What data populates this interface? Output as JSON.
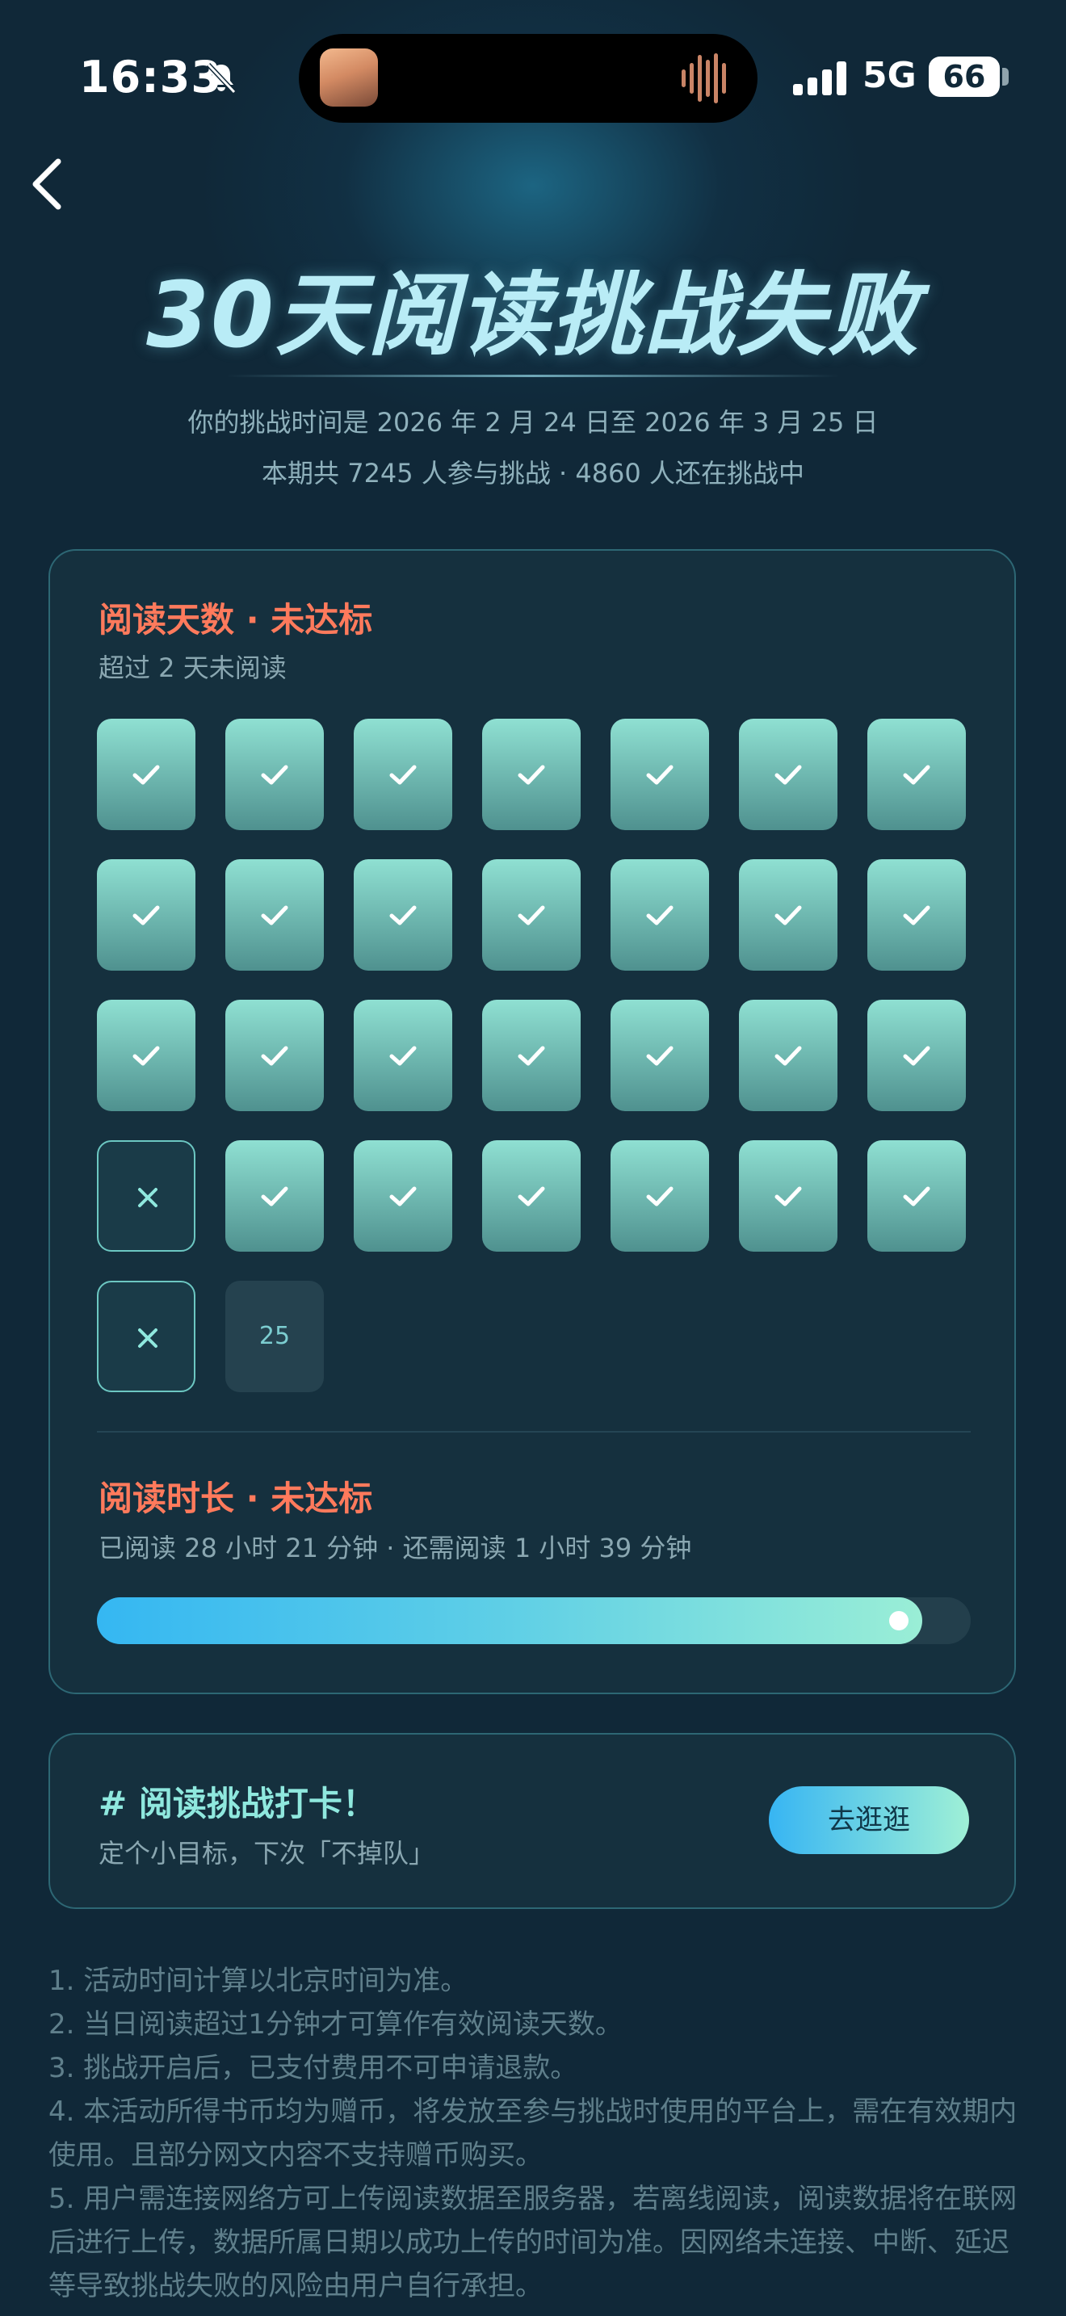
{
  "status_bar": {
    "time": "16:33",
    "network": "5G",
    "battery": "66",
    "icons": [
      "bell-muted-icon",
      "app-thumbnail-icon",
      "audio-wave-icon",
      "signal-icon",
      "battery-icon"
    ]
  },
  "nav": {
    "back_icon": "chevron-left-icon"
  },
  "header": {
    "title": "30天阅读挑战失败",
    "period": "你的挑战时间是 2026 年 2 月 24 日至 2026 年 3 月 25 日",
    "participants": "本期共 7245 人参与挑战 · 4860 人还在挑战中"
  },
  "days_section": {
    "title": "阅读天数 · 未达标",
    "subtitle": "超过 2 天未阅读",
    "days": [
      {
        "state": "ok"
      },
      {
        "state": "ok"
      },
      {
        "state": "ok"
      },
      {
        "state": "ok"
      },
      {
        "state": "ok"
      },
      {
        "state": "ok"
      },
      {
        "state": "ok"
      },
      {
        "state": "ok"
      },
      {
        "state": "ok"
      },
      {
        "state": "ok"
      },
      {
        "state": "ok"
      },
      {
        "state": "ok"
      },
      {
        "state": "ok"
      },
      {
        "state": "ok"
      },
      {
        "state": "ok"
      },
      {
        "state": "ok"
      },
      {
        "state": "ok"
      },
      {
        "state": "ok"
      },
      {
        "state": "ok"
      },
      {
        "state": "ok"
      },
      {
        "state": "ok"
      },
      {
        "state": "miss"
      },
      {
        "state": "ok"
      },
      {
        "state": "ok"
      },
      {
        "state": "ok"
      },
      {
        "state": "ok"
      },
      {
        "state": "ok"
      },
      {
        "state": "ok"
      },
      {
        "state": "miss"
      },
      {
        "state": "pending",
        "label": "25"
      }
    ]
  },
  "duration_section": {
    "title": "阅读时长 · 未达标",
    "subtitle": "已阅读 28 小时 21 分钟 · 还需阅读 1 小时 39 分钟",
    "progress_fraction": 0.945
  },
  "promo": {
    "title": "# 阅读挑战打卡！",
    "subtitle": "定个小目标，下次「不掉队」",
    "button": "去逛逛"
  },
  "rules": [
    "1. 活动时间计算以北京时间为准。",
    "2. 当日阅读超过1分钟才可算作有效阅读天数。",
    "3. 挑战开启后，已支付费用不可申请退款。",
    "4. 本活动所得书币均为赠币，将发放至参与挑战时使用的平台上，需在有效期内使用。且部分网文内容不支持赠币购买。",
    "5. 用户需连接网络方可上传阅读数据至服务器，若离线阅读，阅读数据将在联网后进行上传，数据所属日期以成功上传的时间为准。因网络未连接、中断、延迟等导致挑战失败的风险由用户自行承担。"
  ],
  "colors": {
    "background": "#102838",
    "accent_fail": "#ff7a5c",
    "accent_teal": "#8fe8de",
    "checked_cell": "#6fbfb4"
  }
}
